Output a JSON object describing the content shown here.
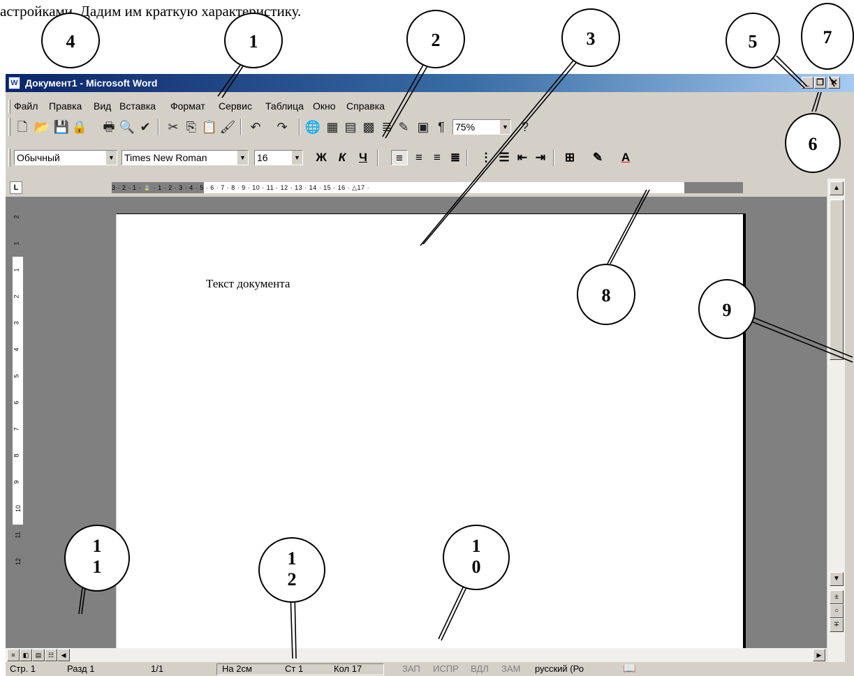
{
  "caption": "астройками. Дадим им краткую характеристику.",
  "window": {
    "title": "Документ1 - Microsoft Word",
    "app_icon": "word-icon",
    "controls": {
      "minimize": "_",
      "restore": "❐",
      "close": "✕"
    }
  },
  "menu": {
    "items": [
      "Файл",
      "Правка",
      "Вид",
      "Вставка",
      "Формат",
      "Сервис",
      "Таблица",
      "Окно",
      "Справка"
    ]
  },
  "standard_toolbar": {
    "zoom": "75%",
    "icons": [
      "new-icon",
      "open-icon",
      "save-icon",
      "permission-icon",
      "print-icon",
      "print-preview-icon",
      "spelling-icon",
      "cut-icon",
      "copy-icon",
      "paste-icon",
      "format-painter-icon",
      "undo-icon",
      "redo-icon",
      "hyperlink-icon",
      "tables-borders-icon",
      "insert-table-icon",
      "insert-excel-icon",
      "columns-icon",
      "drawing-icon",
      "document-map-icon",
      "show-formatting-icon",
      "help-icon"
    ]
  },
  "formatting_toolbar": {
    "style": "Обычный",
    "font": "Times New Roman",
    "size": "16",
    "bold": "Ж",
    "italic": "К",
    "underline": "Ч",
    "align_selected": "left"
  },
  "ruler": {
    "tab_selector": "L",
    "numbers": "3 · 2 · 1 · ⌛ · 1 · 2 · 3 · 4 · 5 · 6 · 7 · 8 · 9 · 10 · 11 · 12 · 13 · 14 · 15 · 16 · △17 ·",
    "vertical_numbers": [
      "2",
      "1",
      "1",
      "2",
      "3",
      "4",
      "5",
      "6",
      "7",
      "8",
      "9",
      "10",
      "11",
      "12"
    ]
  },
  "document": {
    "text": "Текст документа"
  },
  "status_bar": {
    "page": "Стр. 1",
    "section": "Разд 1",
    "pages": "1/1",
    "at": "На 2см",
    "line": "Ст 1",
    "col": "Кол 17",
    "rec": "ЗАП",
    "trk": "ИСПР",
    "ext": "ВДЛ",
    "ovr": "ЗАМ",
    "language": "русский (Ро"
  },
  "callouts": {
    "c1": "1",
    "c2": "2",
    "c3": "3",
    "c4": "4",
    "c5": "5",
    "c6": "6",
    "c7": "7",
    "c8": "8",
    "c9": "9",
    "c10_a": "1",
    "c10_b": "0",
    "c11_a": "1",
    "c11_b": "1",
    "c12_a": "1",
    "c12_b": "2"
  }
}
